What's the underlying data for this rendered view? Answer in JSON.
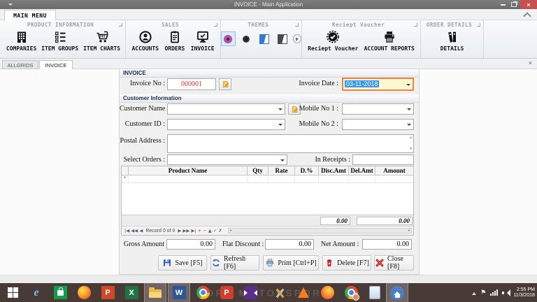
{
  "window": {
    "title": "INVOICE - Main Application"
  },
  "ribbon": {
    "tab_label": "MAIN MENU",
    "groups": [
      {
        "title": "PRODUCT INFORMATION",
        "items": [
          {
            "label": "COMPANIES"
          },
          {
            "label": "ITEM GROUPS"
          },
          {
            "label": "ITEM CHARTS"
          }
        ]
      },
      {
        "title": "SALES",
        "items": [
          {
            "label": "ACCOUNTS"
          },
          {
            "label": "ORDERS"
          },
          {
            "label": "INVOICE"
          }
        ]
      },
      {
        "title": "THEMES",
        "items": []
      },
      {
        "title": "Reciept Voucher",
        "items": [
          {
            "label": "Reciept Voucher"
          },
          {
            "label": "ACCOUNT REPORTS"
          }
        ]
      },
      {
        "title": "ORDER DETAILS",
        "items": [
          {
            "label": "DETAILS"
          }
        ]
      }
    ]
  },
  "tabs": {
    "items": [
      {
        "label": "ALLGRIDS"
      },
      {
        "label": "INVOICE"
      }
    ],
    "close_glyph": "×"
  },
  "form": {
    "header": "INVOICE",
    "invoice_no_label": "Invoice No :",
    "invoice_no_value": "000001",
    "invoice_date_label": "Invoice Date :",
    "invoice_date_value": "03-11-2018",
    "customer_section": "Customer Information",
    "customer_name_label": "Customer Name :",
    "mobile1_label": "Mobile No 1 :",
    "customer_id_label": "Customer ID :",
    "mobile2_label": "Mobile No 2 :",
    "postal_label": "Postal Address :",
    "select_orders_label": "Select Orders :",
    "in_receipts_label": "In Receipts :"
  },
  "grid": {
    "columns": [
      "Product Name",
      "Qty",
      "Rate",
      "D.%",
      "Disc.Amt",
      "Del.Amt",
      "Amount"
    ],
    "new_row_marker": "*",
    "totals": {
      "disc_amt": "0.00",
      "amount": "0.00"
    },
    "navigator": {
      "left": "|◀ ◀◀ ◀",
      "record": "Record 0 of 0",
      "right": "▶ ▶▶ ▶| + − ▲ ✓ ✗"
    }
  },
  "summary": {
    "gross_label": "Gross Amount :",
    "gross_value": "0.00",
    "flat_label": "Flat Discount :",
    "flat_value": "0.00",
    "net_label": "Net Amount :",
    "net_value": "0.00"
  },
  "action_buttons": [
    {
      "label": "Save [F5]"
    },
    {
      "label": "Refresh [F6]"
    },
    {
      "label": "Print [Ctrl+P]"
    },
    {
      "label": "Delete [F7]"
    },
    {
      "label": "Close [F8]"
    }
  ],
  "taskbar": {
    "watermark": "FORD MOTORSPORT",
    "glyphs": {
      "ie": "e",
      "powerpoint": "P",
      "excel": "X",
      "word": "W",
      "p_app": "P"
    },
    "tray": {
      "time": "2:55 PM",
      "date": "11/3/2018"
    }
  },
  "colors": {
    "taskbar_bg": "#483a37",
    "titlebar_bg": "#6a6a6a",
    "close_btn": "#c75050",
    "date_field_bg": "#fdf8cf",
    "date_selection": "#3399ff",
    "date_border": "#f08444",
    "invoice_no_text": "#e03333",
    "theme_selected_bg": "#dce9f7"
  }
}
